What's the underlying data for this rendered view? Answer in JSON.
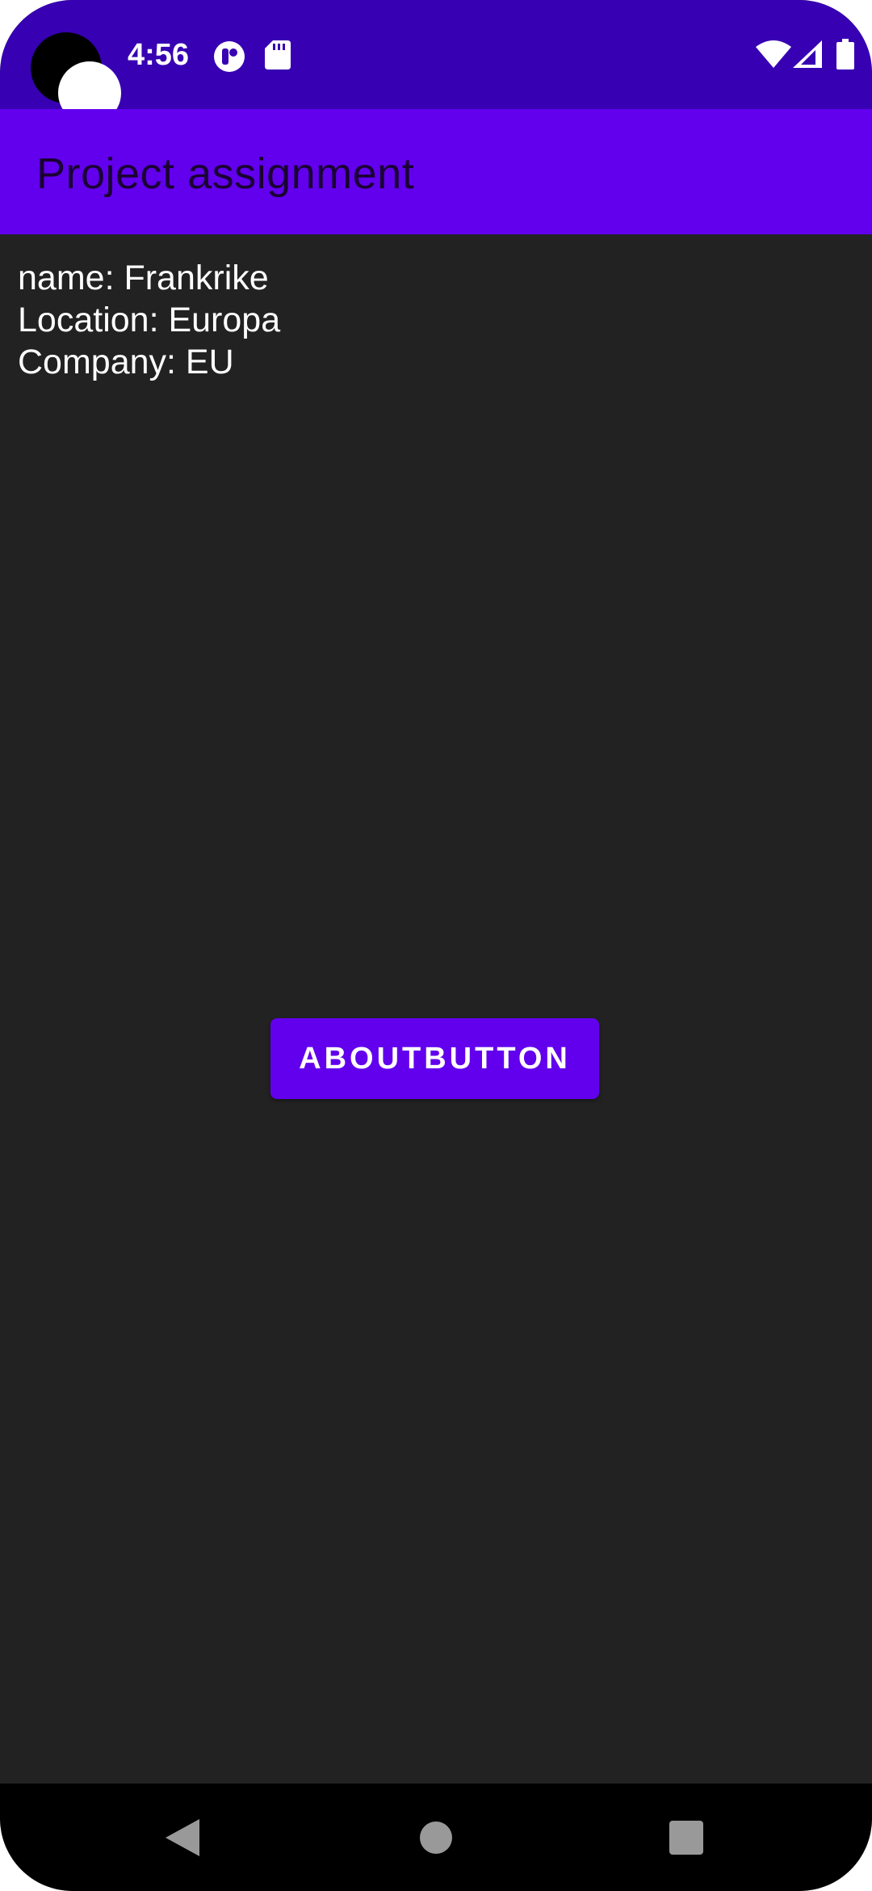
{
  "status_bar": {
    "time": "4:56",
    "bg_color": "#3700b3",
    "icons": [
      "notification-app-icon",
      "sd-card-icon",
      "wifi-icon",
      "cell-signal-icon",
      "battery-icon"
    ]
  },
  "app_bar": {
    "title": "Project assignment",
    "bg_color": "#6200ee"
  },
  "content": {
    "lines": [
      "name: Frankrike",
      "Location: Europa",
      "Company: EU"
    ],
    "button_label": "ABOUTBUTTON",
    "bg_color": "#222222"
  },
  "nav_bar": {
    "icons": [
      "back-icon",
      "home-icon",
      "recents-icon"
    ]
  }
}
